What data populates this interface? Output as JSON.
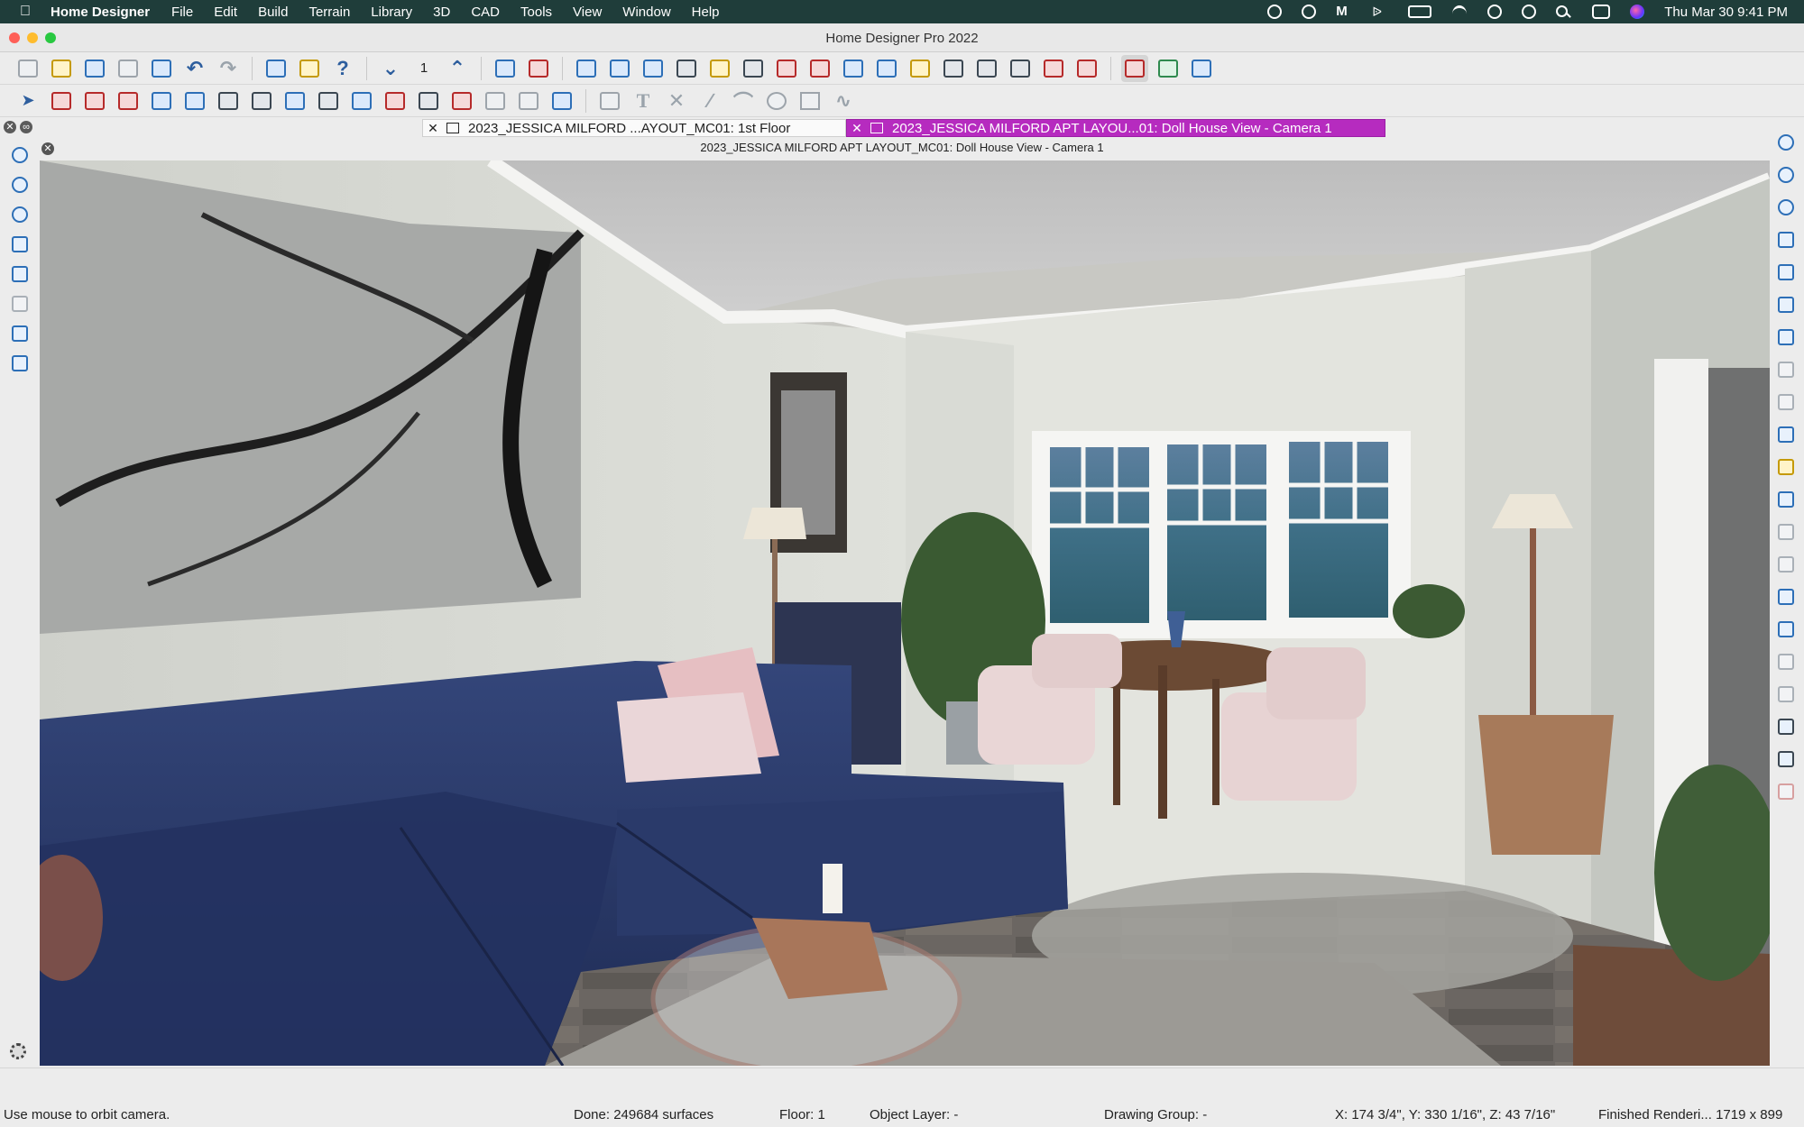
{
  "menubar": {
    "app_name": "Home Designer",
    "menus": [
      "File",
      "Edit",
      "Build",
      "Terrain",
      "Library",
      "3D",
      "CAD",
      "Tools",
      "View",
      "Window",
      "Help"
    ],
    "clock": "Thu Mar 30  9:41 PM"
  },
  "window": {
    "title": "Home Designer Pro 2022"
  },
  "toolbar1": {
    "floor_number": "1"
  },
  "tabs": [
    {
      "label": "2023_JESSICA MILFORD ...AYOUT_MC01: 1st Floor",
      "active": false
    },
    {
      "label": "2023_JESSICA MILFORD APT LAYOU...01: Doll House View - Camera 1",
      "active": true
    }
  ],
  "view": {
    "title": "2023_JESSICA MILFORD APT LAYOUT_MC01: Doll House View - Camera 1"
  },
  "status": {
    "hint": "Use mouse to orbit camera.",
    "surfaces": "Done:  249684 surfaces",
    "floor": "Floor: 1",
    "object_layer": "Object Layer: -",
    "drawing_group": "Drawing Group: -",
    "coords": "X: 174 3/4\", Y: 330 1/16\", Z: 43 7/16\"",
    "render": "Finished Renderi...  1719 x 899"
  },
  "colors": {
    "menubar": "#1f3d3a",
    "active_tab": "#b62bbf",
    "sofa": "#2b3a63",
    "wall": "#d7dad3"
  }
}
